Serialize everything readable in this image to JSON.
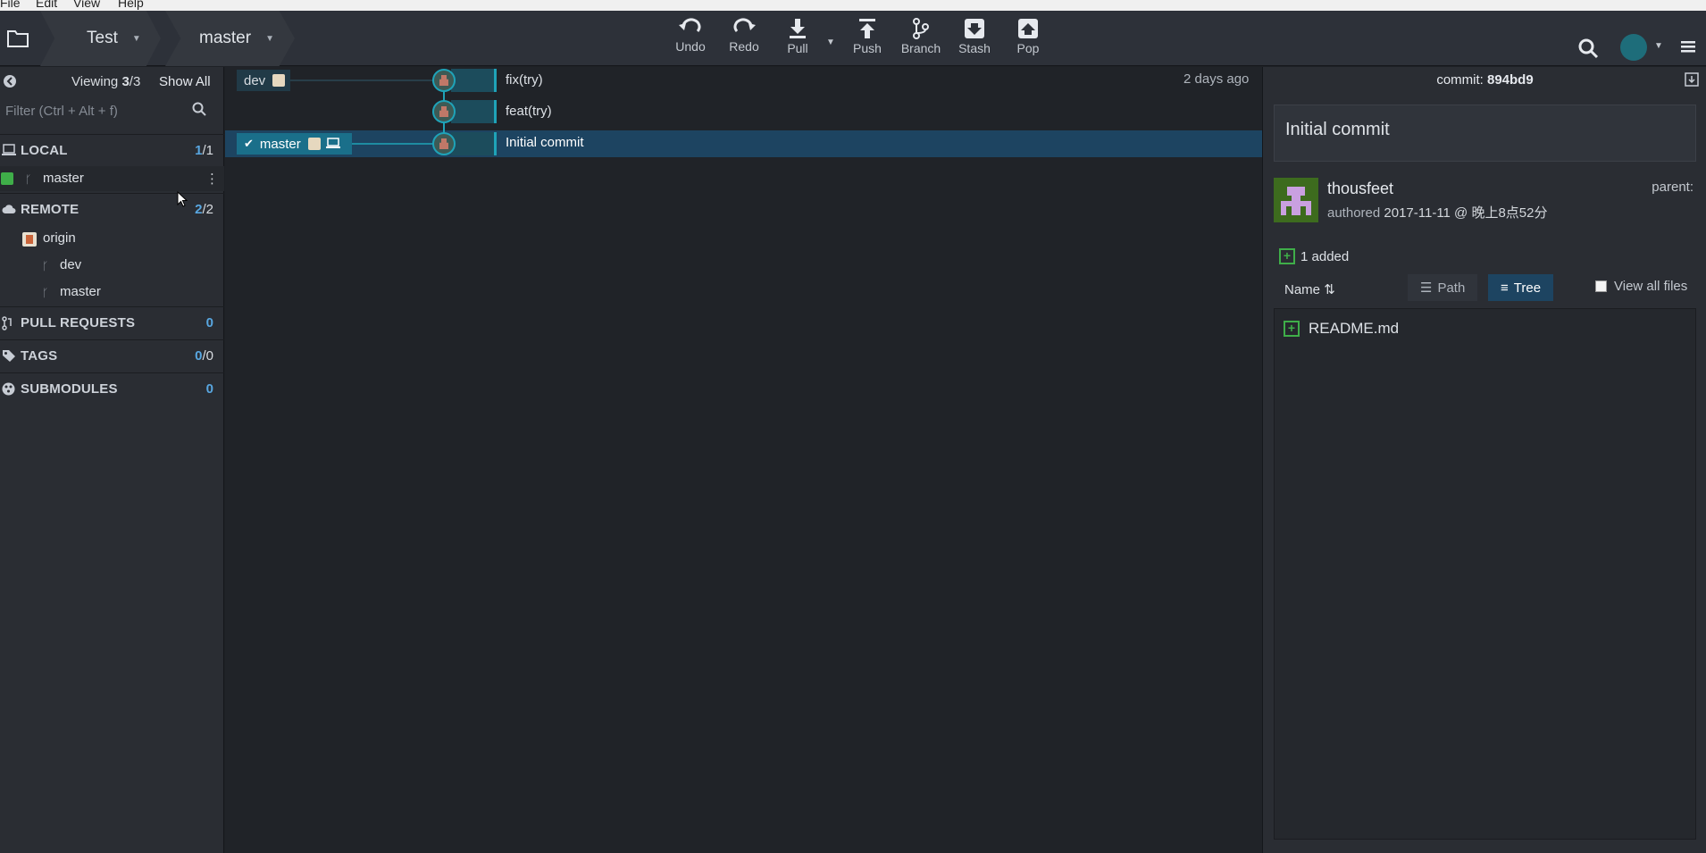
{
  "menubar": {
    "items": [
      "File",
      "Edit",
      "View",
      "Help"
    ]
  },
  "toolbar": {
    "repo": "Test",
    "branch": "master",
    "buttons": {
      "undo": "Undo",
      "redo": "Redo",
      "pull": "Pull",
      "push": "Push",
      "branch": "Branch",
      "stash": "Stash",
      "pop": "Pop"
    }
  },
  "left_panel": {
    "viewing_label": "Viewing",
    "viewing_count": "3",
    "viewing_total": "/3",
    "show_all": "Show All",
    "filter_placeholder": "Filter (Ctrl + Alt + f)",
    "local": {
      "title": "LOCAL",
      "count": "1",
      "total": "/1",
      "branches": [
        "master"
      ]
    },
    "remote": {
      "title": "REMOTE",
      "count": "2",
      "total": "/2",
      "origin": "origin",
      "branches": [
        "dev",
        "master"
      ]
    },
    "pull_requests": {
      "title": "PULL REQUESTS",
      "count": "0"
    },
    "tags": {
      "title": "TAGS",
      "count": "0",
      "total": "/0"
    },
    "submodules": {
      "title": "SUBMODULES",
      "count": "0"
    }
  },
  "graph": {
    "timestamp": "2 days ago",
    "branch_refs": [
      "dev",
      "master"
    ],
    "commits": [
      {
        "message": "fix(try)"
      },
      {
        "message": "feat(try)"
      },
      {
        "message": "Initial commit"
      }
    ]
  },
  "right_panel": {
    "commit_label": "commit:",
    "commit_hash": "894bd9",
    "summary": "Initial commit",
    "author": "thousfeet",
    "authored_label": "authored",
    "authored_date": "2017-11-11 @ 晚上8点52分",
    "parent_label": "parent:",
    "added_count": "1 added",
    "sort_label": "Name",
    "path_label": "Path",
    "tree_label": "Tree",
    "view_all_files": "View all files",
    "files": [
      "README.md"
    ]
  },
  "colors": {
    "accent": "#1fa3b8",
    "added": "#3fae49",
    "selected": "#1d4461"
  }
}
